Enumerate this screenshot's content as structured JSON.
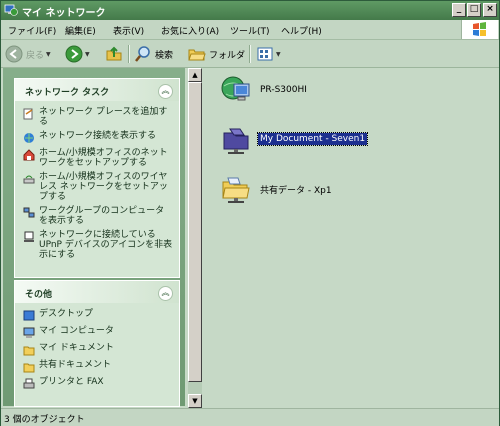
{
  "window": {
    "title": "マイ ネットワーク"
  },
  "title_buttons": {
    "minimize": "_",
    "maximize": "□",
    "close": "×"
  },
  "menu": [
    "ファイル(F)",
    "編集(E)",
    "表示(V)",
    "お気に入り(A)",
    "ツール(T)",
    "ヘルプ(H)"
  ],
  "toolbar": {
    "back": "戻る",
    "search": "検索",
    "folders": "フォルダ"
  },
  "left_panel": {
    "network_tasks": {
      "title": "ネットワーク タスク",
      "items": [
        {
          "label": "ネットワーク プレースを追加する",
          "icon": "add-network-place-icon"
        },
        {
          "label": "ネットワーク接続を表示する",
          "icon": "network-connections-icon"
        },
        {
          "label": "ホーム/小規模オフィスのネットワークをセットアップする",
          "icon": "home-network-setup-icon"
        },
        {
          "label": "ホーム/小規模オフィスのワイヤレス ネットワークをセットアップする",
          "icon": "wireless-network-setup-icon"
        },
        {
          "label": "ワークグループのコンピュータを表示する",
          "icon": "workgroup-computers-icon"
        },
        {
          "label": "ネットワークに接続している UPnP デバイスのアイコンを非表示にする",
          "icon": "upnp-devices-icon"
        }
      ]
    },
    "other_places": {
      "title": "その他",
      "items": [
        {
          "label": "デスクトップ",
          "icon": "desktop-icon"
        },
        {
          "label": "マイ コンピュータ",
          "icon": "my-computer-icon"
        },
        {
          "label": "マイ ドキュメント",
          "icon": "my-documents-icon"
        },
        {
          "label": "共有ドキュメント",
          "icon": "shared-documents-icon"
        },
        {
          "label": "プリンタと FAX",
          "icon": "printers-fax-icon"
        }
      ]
    }
  },
  "content": {
    "items": [
      {
        "label": "PR-S300HI",
        "icon": "network-globe-computer-icon",
        "selected": false
      },
      {
        "label": "My Document - Seven1",
        "icon": "network-share-folder-icon",
        "selected": true
      },
      {
        "label": "共有データ - Xp1",
        "icon": "network-shared-folder-icon",
        "selected": false
      }
    ]
  },
  "status": {
    "text": "3 個のオブジェクト"
  }
}
